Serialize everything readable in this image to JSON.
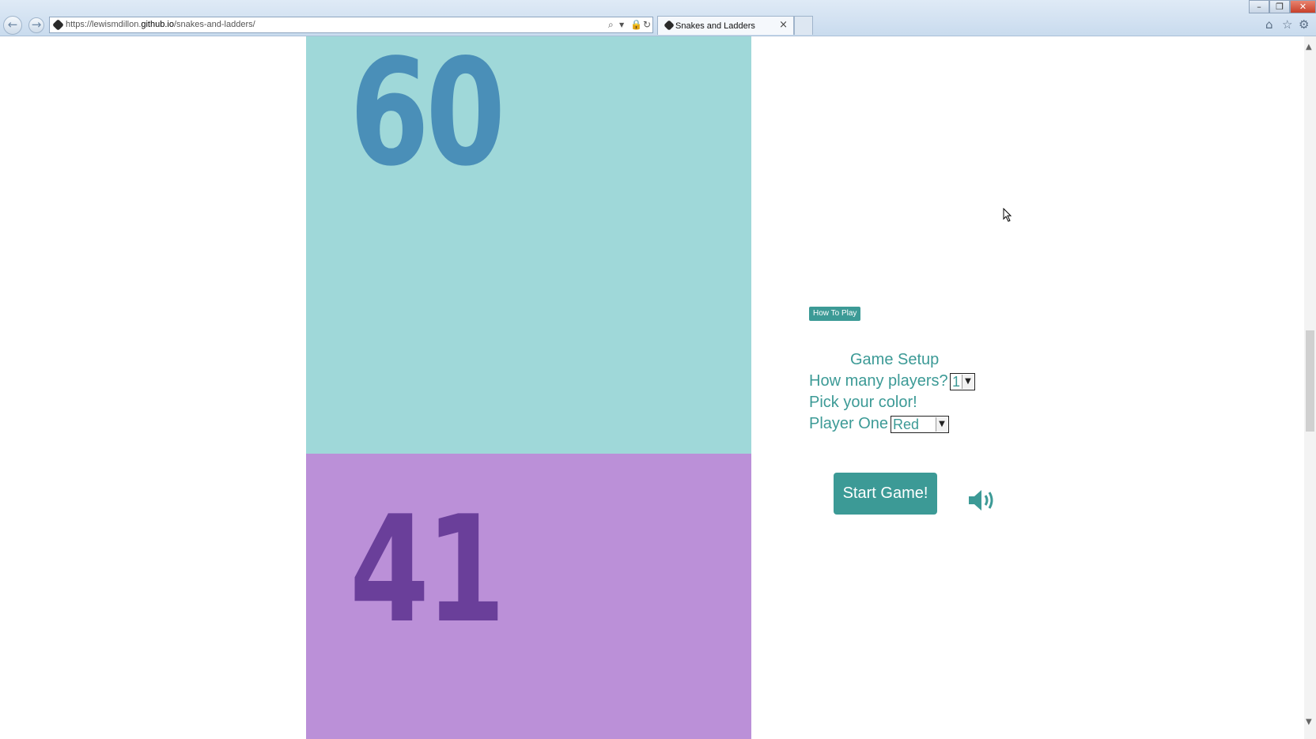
{
  "browser": {
    "url_prefix": "https://lewismdillon.",
    "url_host": "github.io",
    "url_path": "/snakes-and-ladders/",
    "tab_title": "Snakes and Ladders",
    "tab_close": "×"
  },
  "board": {
    "tiles": [
      {
        "number": "60",
        "color": "#9fd8d9"
      },
      {
        "number": "41",
        "color": "#bb90d8"
      }
    ]
  },
  "sidebar": {
    "how_to_play": "How To Play",
    "setup_title": "Game Setup",
    "players_label": "How many players?",
    "players_value": "1",
    "pick_color_label": "Pick your color!",
    "player_one_label": "Player One",
    "player_one_color": "Red",
    "start_button": "Start Game!"
  },
  "colors": {
    "accent": "#3c9a96"
  }
}
